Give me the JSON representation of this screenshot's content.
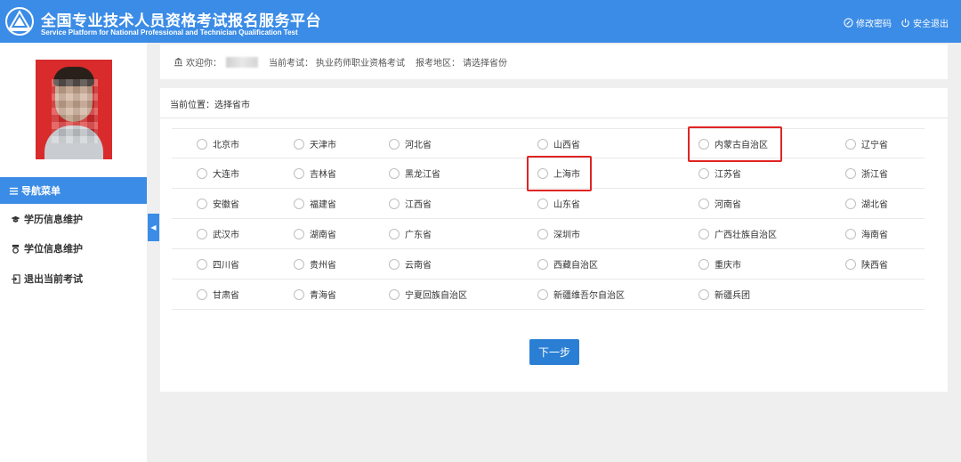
{
  "header": {
    "title_cn": "全国专业技术人员资格考试报名服务平台",
    "title_en": "Service Platform for National Professional and Technician Qualification Test",
    "change_password": "修改密码",
    "logout": "安全退出"
  },
  "sidebar": {
    "nav_title": "导航菜单",
    "items": [
      {
        "label": "学历信息维护",
        "icon": "graduation-cap-icon"
      },
      {
        "label": "学位信息维护",
        "icon": "medal-icon"
      },
      {
        "label": "退出当前考试",
        "icon": "exit-icon"
      }
    ],
    "collapse_glyph": "◀"
  },
  "infobar": {
    "welcome_label": "欢迎你：",
    "exam_label": "当前考试：",
    "exam_value": "执业药师职业资格考试",
    "region_label": "报考地区：",
    "region_value": "请选择省份"
  },
  "main": {
    "crumb": "当前位置：选择省市",
    "provinces": [
      [
        "北京市",
        "天津市",
        "河北省",
        "山西省",
        "内蒙古自治区",
        "辽宁省"
      ],
      [
        "大连市",
        "吉林省",
        "黑龙江省",
        "上海市",
        "江苏省",
        "浙江省"
      ],
      [
        "安徽省",
        "福建省",
        "江西省",
        "山东省",
        "河南省",
        "湖北省"
      ],
      [
        "武汉市",
        "湖南省",
        "广东省",
        "深圳市",
        "广西壮族自治区",
        "海南省"
      ],
      [
        "四川省",
        "贵州省",
        "云南省",
        "西藏自治区",
        "重庆市",
        "陕西省"
      ],
      [
        "甘肃省",
        "青海省",
        "宁夏回族自治区",
        "新疆维吾尔自治区",
        "新疆兵团"
      ]
    ],
    "highlighted": [
      "内蒙古自治区",
      "上海市"
    ],
    "next_label": "下一步"
  },
  "colors": {
    "brand": "#3b8ce6",
    "button": "#2a7fd4",
    "highlight_border": "#e02424"
  }
}
